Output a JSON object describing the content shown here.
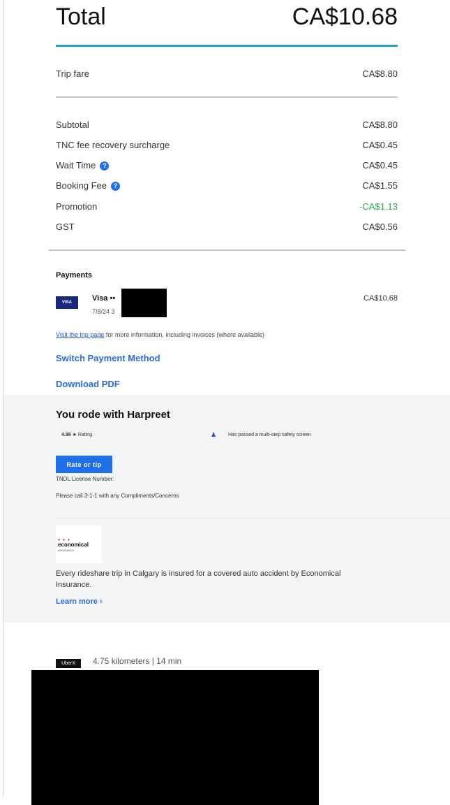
{
  "total": {
    "label": "Total",
    "value": "CA$10.68"
  },
  "trip_fare": {
    "label": "Trip fare",
    "value": "CA$8.80"
  },
  "breakdown": [
    {
      "label": "Subtotal",
      "value": "CA$8.80",
      "info": false
    },
    {
      "label": "TNC fee recovery surcharge",
      "value": "CA$0.45",
      "info": false
    },
    {
      "label": "Wait Time",
      "value": "CA$0.45",
      "info": true
    },
    {
      "label": "Booking Fee",
      "value": "CA$1.55",
      "info": true
    },
    {
      "label": "Promotion",
      "value": "-CA$1.13",
      "info": false
    },
    {
      "label": "GST",
      "value": "CA$0.56",
      "info": false
    }
  ],
  "info_icon_glyph": "?",
  "payments": {
    "heading": "Payments",
    "card_brand": "VISA",
    "card_name": "Visa ••",
    "card_date": "7/8/24 3",
    "amount": "CA$10.68",
    "trip_link": "Visit the trip page",
    "trip_note": " for more information, including invoices (where available)",
    "switch_method": "Switch Payment Method",
    "download_pdf": "Download PDF"
  },
  "driver": {
    "title": "You rode with Harpreet",
    "rating_value": "4.98 ★",
    "rating_label": "Rating",
    "safety_text": "Has passed a multi-step safety screen",
    "rate_button": "Rate or tip",
    "tndl_label": "TNDL License Number:",
    "call_note": "Please call 3-1-1 with any Compliments/Concerns"
  },
  "insurance": {
    "logo_dots": "• • •",
    "logo_word": "economical",
    "logo_sub": "INSURANCE",
    "text": "Every rideshare trip in Calgary is insured for a covered auto accident by Economical Insurance.",
    "learn_more": "Learn more ›"
  },
  "trip": {
    "product": "UberX",
    "stats": "4.75 kilometers | 14 min"
  },
  "colors": {
    "accent_teal": "#21a3c4",
    "link_blue": "#2a6ae0",
    "promo_green": "#2aa84a",
    "button_blue": "#1f6fe8"
  }
}
